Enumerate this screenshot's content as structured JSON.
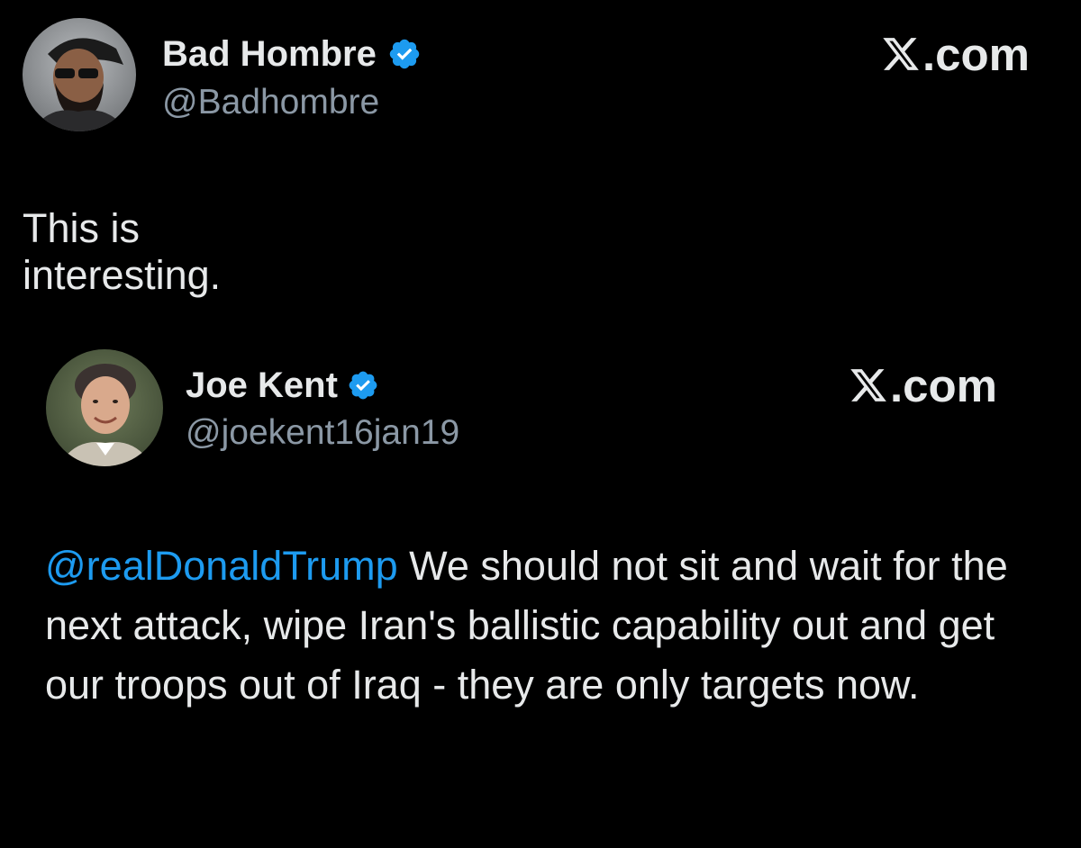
{
  "outer_tweet": {
    "name": "Bad Hombre",
    "handle": "@Badhombre",
    "brand": ".com",
    "text": "This is interesting."
  },
  "quoted_tweet": {
    "name": "Joe Kent",
    "handle": "@joekent16jan19",
    "brand": ".com",
    "mention": "@realDonaldTrump",
    "text": " We should not sit and wait for the next attack, wipe Iran's ballistic capability out and get our troops out of Iraq - they are only targets now."
  },
  "icons": {
    "verified": "verified-badge-icon",
    "brand_logo": "x-logo-icon"
  },
  "colors": {
    "background": "#000000",
    "text": "#e7e9ea",
    "secondary_text": "#8b98a5",
    "link": "#1d9bf0",
    "verified": "#1d9bf0"
  }
}
